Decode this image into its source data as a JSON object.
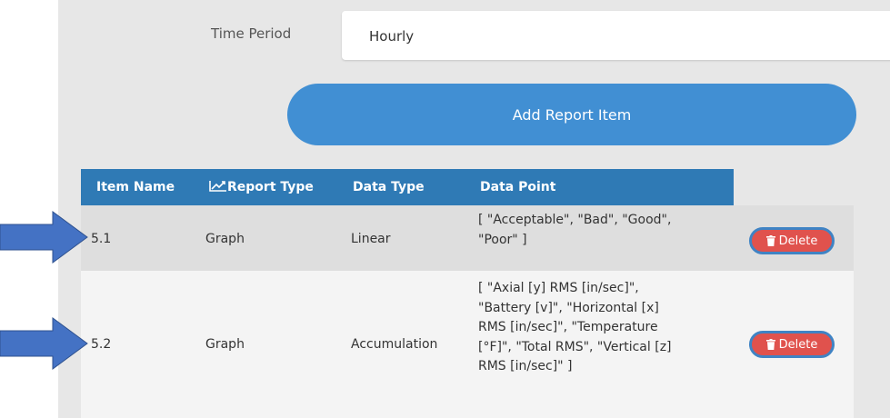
{
  "form": {
    "time_period_label": "Time Period",
    "time_period_value": "Hourly"
  },
  "add_button_label": "Add Report Item",
  "table": {
    "headers": [
      "Item Name",
      "Report Type",
      "Data Type",
      "Data Point"
    ],
    "rows": [
      {
        "item_name": "5.1",
        "report_type": "Graph",
        "data_type": "Linear",
        "data_point_lines": [
          "[ \"Acceptable\", \"Bad\", \"Good\",",
          "\"Poor\" ]"
        ],
        "delete_label": "Delete"
      },
      {
        "item_name": "5.2",
        "report_type": "Graph",
        "data_type": "Accumulation",
        "data_point_lines": [
          "[ \"Axial [y] RMS [in/sec]\",",
          "\"Battery [v]\", \"Horizontal [x]",
          "RMS [in/sec]\", \"Temperature",
          "[°F]\", \"Total RMS\", \"Vertical [z]",
          "RMS [in/sec]\" ]"
        ],
        "delete_label": "Delete"
      }
    ]
  },
  "icons": {
    "report_type_header": "line-chart-icon",
    "delete": "trash-icon",
    "select": "chevron-down-icon",
    "pointer": "arrow-right-icon"
  },
  "colors": {
    "panel": "#e7e7e7",
    "accent": "#418fd3",
    "table_header": "#2f7ab5",
    "delete": "#e0524d",
    "arrow": "#4472c4"
  }
}
